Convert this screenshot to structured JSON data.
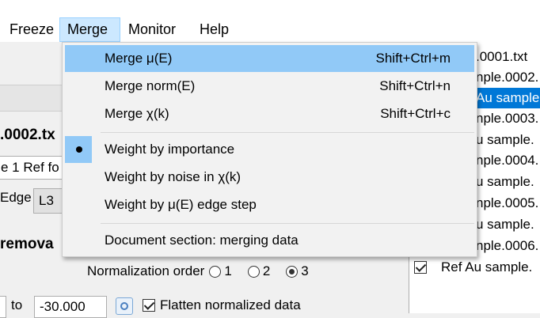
{
  "menubar": {
    "items": [
      "Freeze",
      "Merge",
      "Monitor",
      "Help"
    ]
  },
  "merge_menu": {
    "items": [
      {
        "label": "Merge μ(E)",
        "shortcut": "Shift+Ctrl+m"
      },
      {
        "label": "Merge norm(E)",
        "shortcut": "Shift+Ctrl+n"
      },
      {
        "label": "Merge χ(k)",
        "shortcut": "Shift+Ctrl+c"
      }
    ],
    "weights": [
      {
        "label": "Weight by importance",
        "checked": true
      },
      {
        "label": "Weight by noise in χ(k)",
        "checked": false
      },
      {
        "label": "Weight by μ(E) edge step",
        "checked": false
      }
    ],
    "doc": "Document section: merging data"
  },
  "main": {
    "filename": ".0002.tx",
    "sample_text": "e 1 Ref fo",
    "edge_label": "Edge",
    "edge_value": "L3",
    "removal_label": "remova",
    "norm_order_label": "Normalization order",
    "norm_orders": [
      "1",
      "2",
      "3"
    ],
    "norm_order_selected": "3",
    "to_label": "to",
    "to_value": "-30.000",
    "flatten_label": "Flatten normalized data",
    "flatten_checked": true
  },
  "filelist": {
    "items": [
      ".0001.txt",
      "nple.0002.",
      "Au sample.",
      "nple.0003.",
      "u sample.",
      "nple.0004.",
      "u sample.",
      "nple.0005.",
      "u sample.",
      "nple.0006."
    ],
    "selected_index": 2,
    "last_item": "Ref Au sample."
  }
}
